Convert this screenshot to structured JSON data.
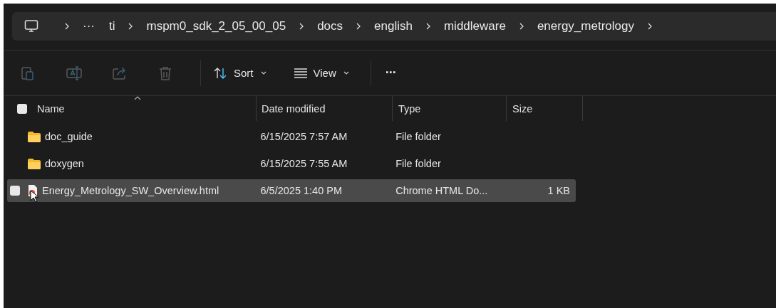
{
  "breadcrumb": {
    "overflow": "···",
    "items": [
      "ti",
      "mspm0_sdk_2_05_00_05",
      "docs",
      "english",
      "middleware",
      "energy_metrology"
    ]
  },
  "toolbar": {
    "actions": [
      {
        "kind": "paste",
        "disabled": true
      },
      {
        "kind": "rename",
        "disabled": true
      },
      {
        "kind": "share",
        "disabled": true
      },
      {
        "kind": "delete",
        "disabled": true
      }
    ],
    "menus": [
      {
        "kind": "sort",
        "label": "Sort"
      },
      {
        "kind": "view",
        "label": "View"
      }
    ],
    "more": "···"
  },
  "table": {
    "select_all": {
      "checked": false
    },
    "columns": [
      "Name",
      "Date modified",
      "Type",
      "Size"
    ],
    "rows": [
      {
        "kind": "folder",
        "name": "doc_guide",
        "date": "6/15/2025 7:57 AM",
        "type": "File folder",
        "size": "",
        "selected": false
      },
      {
        "kind": "folder",
        "name": "doxygen",
        "date": "6/15/2025 7:55 AM",
        "type": "File folder",
        "size": "",
        "selected": false
      },
      {
        "kind": "html",
        "name": "Energy_Metrology_SW_Overview.html",
        "date": "6/5/2025 1:40 PM",
        "type": "Chrome HTML Do...",
        "size": "1 KB",
        "selected": true
      }
    ]
  }
}
